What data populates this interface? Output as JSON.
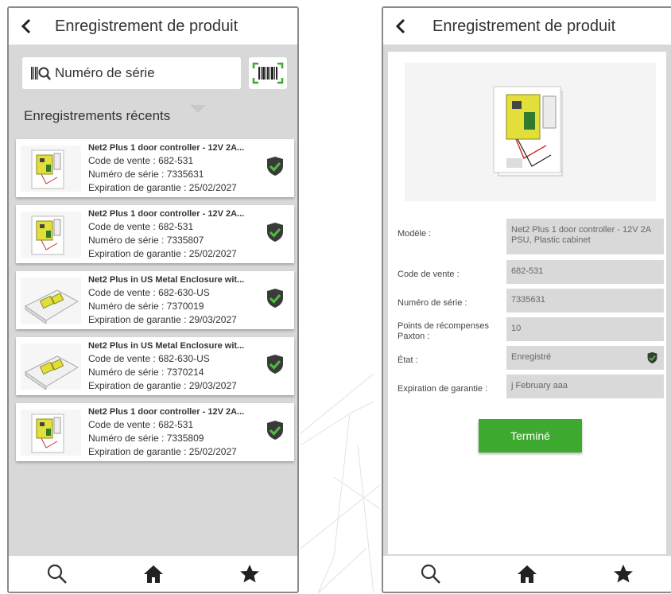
{
  "colors": {
    "accent_green": "#3da92e",
    "shield_dark": "#3a3a3a",
    "check_green": "#4cbf3c"
  },
  "list_screen": {
    "title": "Enregistrement de produit",
    "search_placeholder": "Numéro de série",
    "recent_heading": "Enregistrements récents",
    "records": [
      {
        "name": "Net2 Plus 1 door controller - 12V 2A...",
        "sale_label": "Code de vente :",
        "sale_code": "682-531",
        "serial_label": "Numéro de série :",
        "serial": "7335631",
        "warranty_label": "Expiration de garantie :",
        "warranty": "25/02/2027",
        "image": "controller-cabinet"
      },
      {
        "name": "Net2 Plus 1 door controller - 12V 2A...",
        "sale_label": "Code de vente :",
        "sale_code": "682-531",
        "serial_label": "Numéro de série :",
        "serial": "7335807",
        "warranty_label": "Expiration de garantie :",
        "warranty": "25/02/2027",
        "image": "controller-cabinet"
      },
      {
        "name": "Net2 Plus in US Metal Enclosure wit...",
        "sale_label": "Code de vente :",
        "sale_code": "682-630-US",
        "serial_label": "Numéro de série :",
        "serial": "7370019",
        "warranty_label": "Expiration de garantie :",
        "warranty": "29/03/2027",
        "image": "metal-enclosure"
      },
      {
        "name": "Net2 Plus in US Metal Enclosure wit...",
        "sale_label": "Code de vente :",
        "sale_code": "682-630-US",
        "serial_label": "Numéro de série :",
        "serial": "7370214",
        "warranty_label": "Expiration de garantie :",
        "warranty": "29/03/2027",
        "image": "metal-enclosure"
      },
      {
        "name": "Net2 Plus 1 door controller - 12V 2A...",
        "sale_label": "Code de vente :",
        "sale_code": "682-531",
        "serial_label": "Numéro de série :",
        "serial": "7335809",
        "warranty_label": "Expiration de garantie :",
        "warranty": "25/02/2027",
        "image": "controller-cabinet"
      }
    ],
    "tabs": [
      "search-icon",
      "home-icon",
      "star-icon"
    ]
  },
  "detail_screen": {
    "title": "Enregistrement de produit",
    "fields": {
      "model_label": "Modèle :",
      "model_value": "Net2 Plus 1 door controller - 12V 2A PSU, Plastic cabinet",
      "sale_label": "Code de vente :",
      "sale_value": "682-531",
      "serial_label": "Numéro de série :",
      "serial_value": "7335631",
      "points_label": "Points de récompenses Paxton :",
      "points_value": "10",
      "state_label": "État :",
      "state_value": "Enregistré",
      "warranty_label": "Expiration de garantie :",
      "warranty_value": "j February aaa"
    },
    "done_button": "Terminé",
    "tabs": [
      "search-icon",
      "home-icon",
      "star-icon"
    ]
  }
}
